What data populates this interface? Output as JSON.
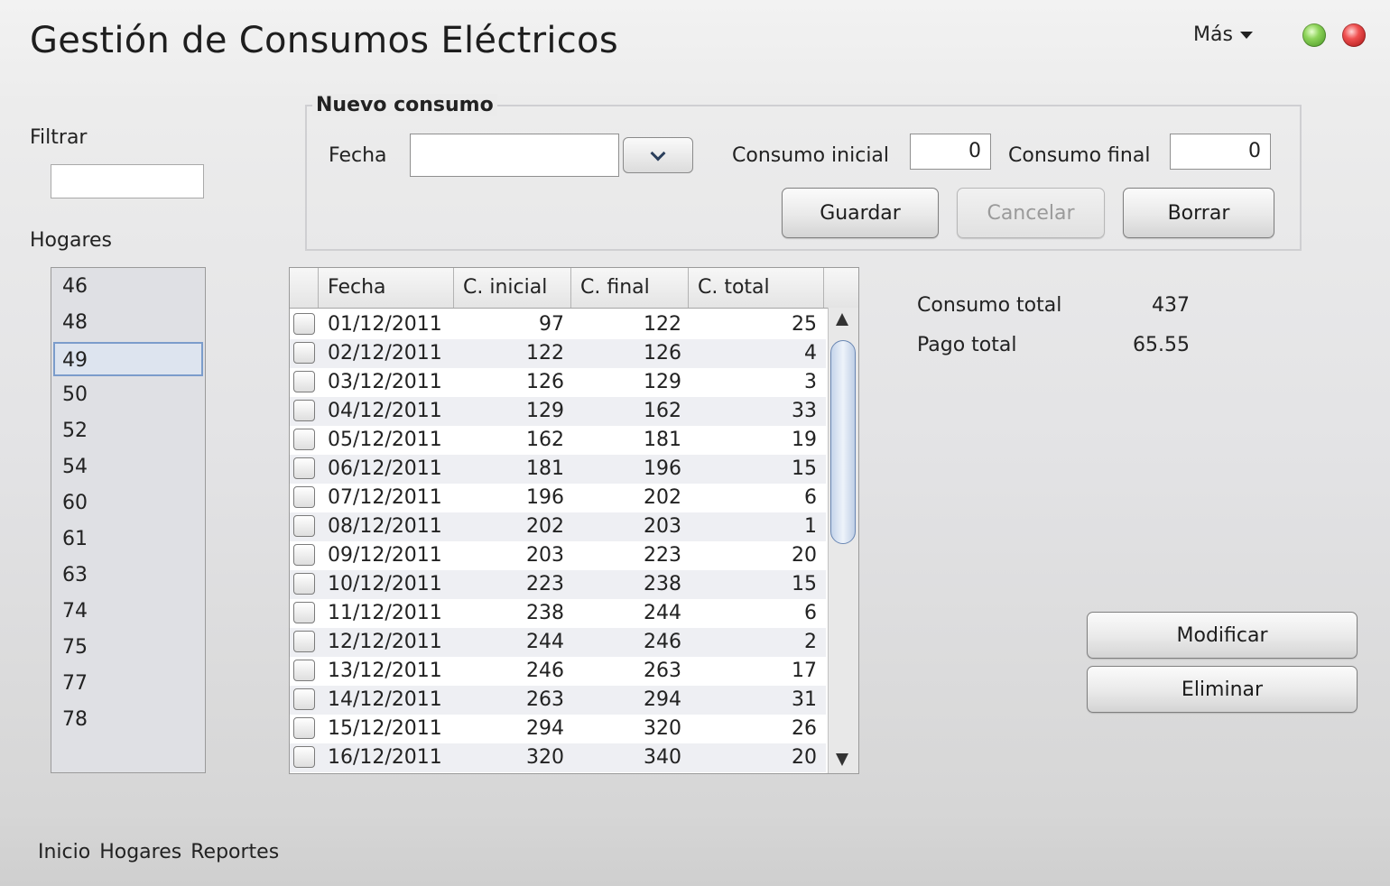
{
  "app": {
    "title": "Gestión de Consumos Eléctricos",
    "menu_label": "Más"
  },
  "sidebar": {
    "filter_label": "Filtrar",
    "filter_value": "",
    "list_label": "Hogares",
    "items": [
      "46",
      "48",
      "49",
      "50",
      "52",
      "54",
      "60",
      "61",
      "63",
      "74",
      "75",
      "77",
      "78"
    ],
    "selected": "49"
  },
  "form": {
    "legend": "Nuevo consumo",
    "fecha_label": "Fecha",
    "fecha_value": "",
    "consumo_inicial_label": "Consumo inicial",
    "consumo_inicial_value": "0",
    "consumo_final_label": "Consumo final",
    "consumo_final_value": "0",
    "guardar": "Guardar",
    "cancelar": "Cancelar",
    "borrar": "Borrar"
  },
  "table": {
    "columns": [
      "Fecha",
      "C. inicial",
      "C. final",
      "C. total"
    ],
    "rows": [
      [
        "01/12/2011",
        "97",
        "122",
        "25"
      ],
      [
        "02/12/2011",
        "122",
        "126",
        "4"
      ],
      [
        "03/12/2011",
        "126",
        "129",
        "3"
      ],
      [
        "04/12/2011",
        "129",
        "162",
        "33"
      ],
      [
        "05/12/2011",
        "162",
        "181",
        "19"
      ],
      [
        "06/12/2011",
        "181",
        "196",
        "15"
      ],
      [
        "07/12/2011",
        "196",
        "202",
        "6"
      ],
      [
        "08/12/2011",
        "202",
        "203",
        "1"
      ],
      [
        "09/12/2011",
        "203",
        "223",
        "20"
      ],
      [
        "10/12/2011",
        "223",
        "238",
        "15"
      ],
      [
        "11/12/2011",
        "238",
        "244",
        "6"
      ],
      [
        "12/12/2011",
        "244",
        "246",
        "2"
      ],
      [
        "13/12/2011",
        "246",
        "263",
        "17"
      ],
      [
        "14/12/2011",
        "263",
        "294",
        "31"
      ],
      [
        "15/12/2011",
        "294",
        "320",
        "26"
      ],
      [
        "16/12/2011",
        "320",
        "340",
        "20"
      ]
    ]
  },
  "summary": {
    "consumo_total_label": "Consumo total",
    "consumo_total_value": "437",
    "pago_total_label": "Pago total",
    "pago_total_value": "65.55"
  },
  "actions": {
    "modificar": "Modificar",
    "eliminar": "Eliminar"
  },
  "bottom_nav": [
    "Inicio",
    "Hogares",
    "Reportes"
  ]
}
